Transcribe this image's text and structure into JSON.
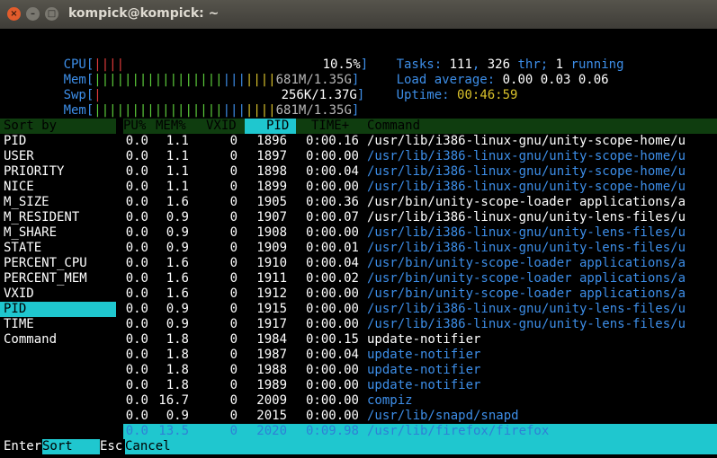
{
  "window": {
    "title": "kompick@kompick: ~"
  },
  "header": {
    "cpu_label": "CPU[",
    "cpu_bars": "||||",
    "cpu_value": "10.5%",
    "mem_label": "Mem[",
    "mem_bars_green": "|||||||||||||||||",
    "mem_bars_blue": "|||",
    "mem_bars_yellow": "||||",
    "mem_value": "681M/1.35G",
    "swp_label": "Swp[",
    "swp_bars": "|",
    "swp_value": "256K/1.37G",
    "tasks_label": "Tasks:",
    "tasks_count": "111",
    "thr_count": "326",
    "thr_label": "thr;",
    "running_count": "1",
    "running_label": "running",
    "load_label": "Load average:",
    "load_values": "0.00 0.03 0.06",
    "uptime_label": "Uptime:",
    "uptime_value": "00:46:59",
    "close_bracket": "]"
  },
  "sort_panel": {
    "title": "Sort by",
    "items": [
      "PID",
      "USER",
      "PRIORITY",
      "NICE",
      "M_SIZE",
      "M_RESIDENT",
      "M_SHARE",
      "STATE",
      "PERCENT_CPU",
      "PERCENT_MEM",
      "VXID",
      "PID",
      "TIME",
      "Command"
    ],
    "selected": "PID"
  },
  "columns": {
    "cpu": "PU%",
    "mem": "MEM%",
    "vxid": "VXID",
    "pid": "PID",
    "time": "TIME+",
    "command": "Command"
  },
  "rows": [
    {
      "cpu": "0.0",
      "mem": "1.1",
      "vxid": "0",
      "pid": "1896",
      "time": "0:00.16",
      "cmd": "/usr/lib/i386-linux-gnu/unity-scope-home/u",
      "color": "white"
    },
    {
      "cpu": "0.0",
      "mem": "1.1",
      "vxid": "0",
      "pid": "1897",
      "time": "0:00.00",
      "cmd": "/usr/lib/i386-linux-gnu/unity-scope-home/u",
      "color": "blue"
    },
    {
      "cpu": "0.0",
      "mem": "1.1",
      "vxid": "0",
      "pid": "1898",
      "time": "0:00.04",
      "cmd": "/usr/lib/i386-linux-gnu/unity-scope-home/u",
      "color": "blue"
    },
    {
      "cpu": "0.0",
      "mem": "1.1",
      "vxid": "0",
      "pid": "1899",
      "time": "0:00.00",
      "cmd": "/usr/lib/i386-linux-gnu/unity-scope-home/u",
      "color": "blue"
    },
    {
      "cpu": "0.0",
      "mem": "1.6",
      "vxid": "0",
      "pid": "1905",
      "time": "0:00.36",
      "cmd": "/usr/bin/unity-scope-loader applications/a",
      "color": "white"
    },
    {
      "cpu": "0.0",
      "mem": "0.9",
      "vxid": "0",
      "pid": "1907",
      "time": "0:00.07",
      "cmd": "/usr/lib/i386-linux-gnu/unity-lens-files/u",
      "color": "white"
    },
    {
      "cpu": "0.0",
      "mem": "0.9",
      "vxid": "0",
      "pid": "1908",
      "time": "0:00.00",
      "cmd": "/usr/lib/i386-linux-gnu/unity-lens-files/u",
      "color": "blue"
    },
    {
      "cpu": "0.0",
      "mem": "0.9",
      "vxid": "0",
      "pid": "1909",
      "time": "0:00.01",
      "cmd": "/usr/lib/i386-linux-gnu/unity-lens-files/u",
      "color": "blue"
    },
    {
      "cpu": "0.0",
      "mem": "1.6",
      "vxid": "0",
      "pid": "1910",
      "time": "0:00.04",
      "cmd": "/usr/bin/unity-scope-loader applications/a",
      "color": "blue"
    },
    {
      "cpu": "0.0",
      "mem": "1.6",
      "vxid": "0",
      "pid": "1911",
      "time": "0:00.02",
      "cmd": "/usr/bin/unity-scope-loader applications/a",
      "color": "blue"
    },
    {
      "cpu": "0.0",
      "mem": "1.6",
      "vxid": "0",
      "pid": "1912",
      "time": "0:00.00",
      "cmd": "/usr/bin/unity-scope-loader applications/a",
      "color": "blue"
    },
    {
      "cpu": "0.0",
      "mem": "0.9",
      "vxid": "0",
      "pid": "1915",
      "time": "0:00.00",
      "cmd": "/usr/lib/i386-linux-gnu/unity-lens-files/u",
      "color": "blue"
    },
    {
      "cpu": "0.0",
      "mem": "0.9",
      "vxid": "0",
      "pid": "1917",
      "time": "0:00.00",
      "cmd": "/usr/lib/i386-linux-gnu/unity-lens-files/u",
      "color": "blue"
    },
    {
      "cpu": "0.0",
      "mem": "1.8",
      "vxid": "0",
      "pid": "1984",
      "time": "0:00.15",
      "cmd": "update-notifier",
      "color": "white"
    },
    {
      "cpu": "0.0",
      "mem": "1.8",
      "vxid": "0",
      "pid": "1987",
      "time": "0:00.04",
      "cmd": "update-notifier",
      "color": "blue"
    },
    {
      "cpu": "0.0",
      "mem": "1.8",
      "vxid": "0",
      "pid": "1988",
      "time": "0:00.00",
      "cmd": "update-notifier",
      "color": "blue"
    },
    {
      "cpu": "0.0",
      "mem": "1.8",
      "vxid": "0",
      "pid": "1989",
      "time": "0:00.00",
      "cmd": "update-notifier",
      "color": "blue"
    },
    {
      "cpu": "0.0",
      "mem": "16.7",
      "vxid": "0",
      "pid": "2009",
      "time": "0:00.00",
      "cmd": "compiz",
      "color": "blue"
    },
    {
      "cpu": "0.0",
      "mem": "0.9",
      "vxid": "0",
      "pid": "2015",
      "time": "0:00.00",
      "cmd": "/usr/lib/snapd/snapd",
      "color": "blue"
    },
    {
      "cpu": "0.0",
      "mem": "13.5",
      "vxid": "0",
      "pid": "2020",
      "time": "0:09.98",
      "cmd": "/usr/lib/firefox/firefox",
      "color": "blue"
    }
  ],
  "footer": {
    "enter_key": "Enter",
    "enter_action": "Sort",
    "esc_key": "Esc",
    "esc_action": "Cancel"
  },
  "colors": {
    "accent": "#1fc7cf",
    "header_bg": "#0f3d0f",
    "blue_text": "#3d8ee8"
  }
}
